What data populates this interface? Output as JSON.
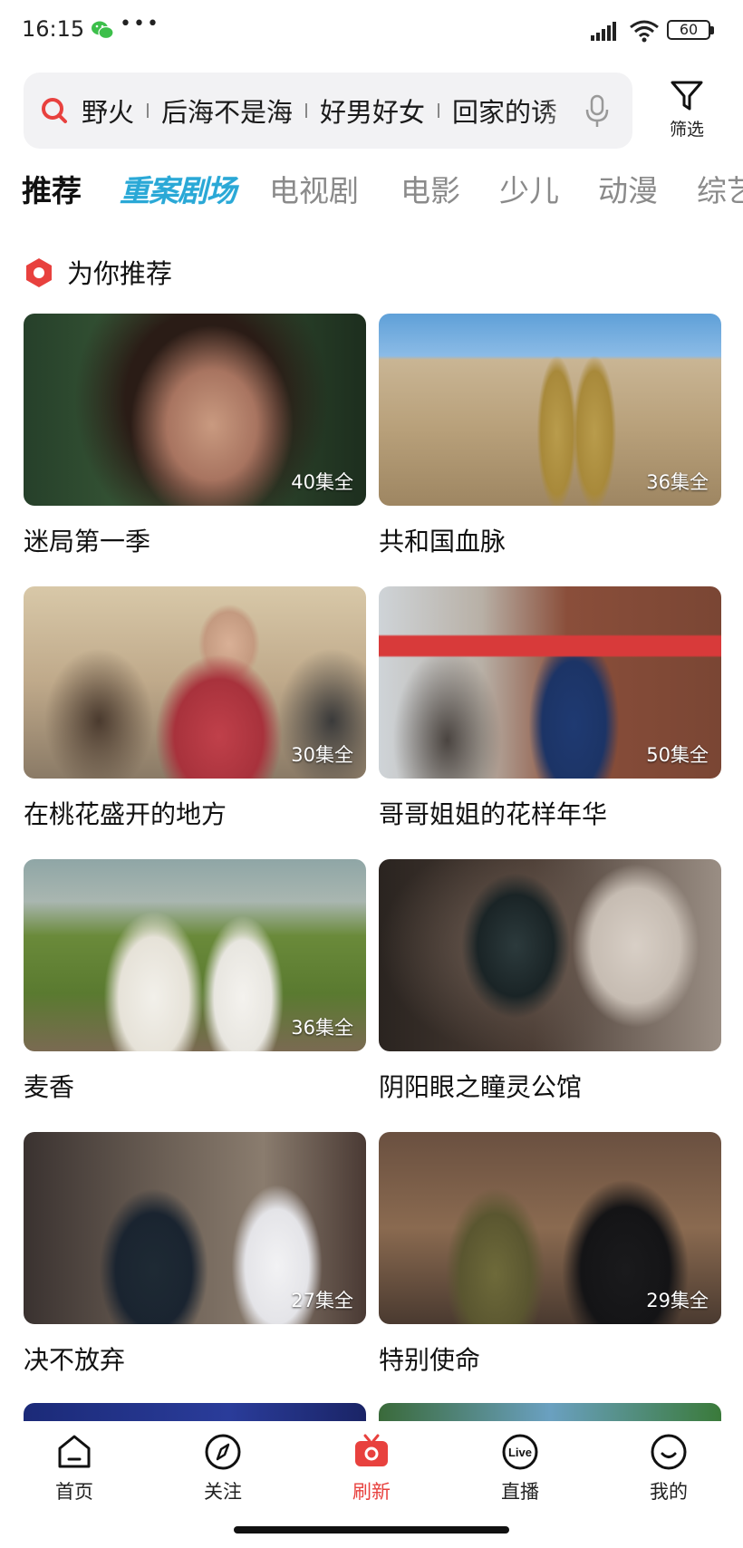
{
  "status": {
    "time": "16:15",
    "dots": "•••",
    "battery": "60"
  },
  "search": {
    "terms": [
      "野火",
      "后海不是海",
      "好男好女",
      "回家的诱"
    ],
    "filter_label": "筛选"
  },
  "tabs": [
    "推荐",
    "重案剧场",
    "电视剧",
    "电影",
    "少儿",
    "动漫",
    "综艺"
  ],
  "section": {
    "title": "为你推荐"
  },
  "cards": [
    {
      "title": "迷局第一季",
      "badge": "40集全"
    },
    {
      "title": "共和国血脉",
      "badge": "36集全"
    },
    {
      "title": "在桃花盛开的地方",
      "badge": "30集全"
    },
    {
      "title": "哥哥姐姐的花样年华",
      "badge": "50集全"
    },
    {
      "title": "麦香",
      "badge": "36集全"
    },
    {
      "title": "阴阳眼之瞳灵公馆",
      "badge": ""
    },
    {
      "title": "决不放弃",
      "badge": "27集全"
    },
    {
      "title": "特别使命",
      "badge": "29集全"
    }
  ],
  "nav": [
    {
      "label": "首页",
      "icon": "home-icon"
    },
    {
      "label": "关注",
      "icon": "compass-icon"
    },
    {
      "label": "刷新",
      "icon": "tv-refresh-icon"
    },
    {
      "label": "直播",
      "icon": "live-icon"
    },
    {
      "label": "我的",
      "icon": "profile-icon"
    }
  ],
  "colors": {
    "accent": "#e8413e",
    "special_tab": "#2aa8d6",
    "search_bg": "#f2f2f4"
  }
}
